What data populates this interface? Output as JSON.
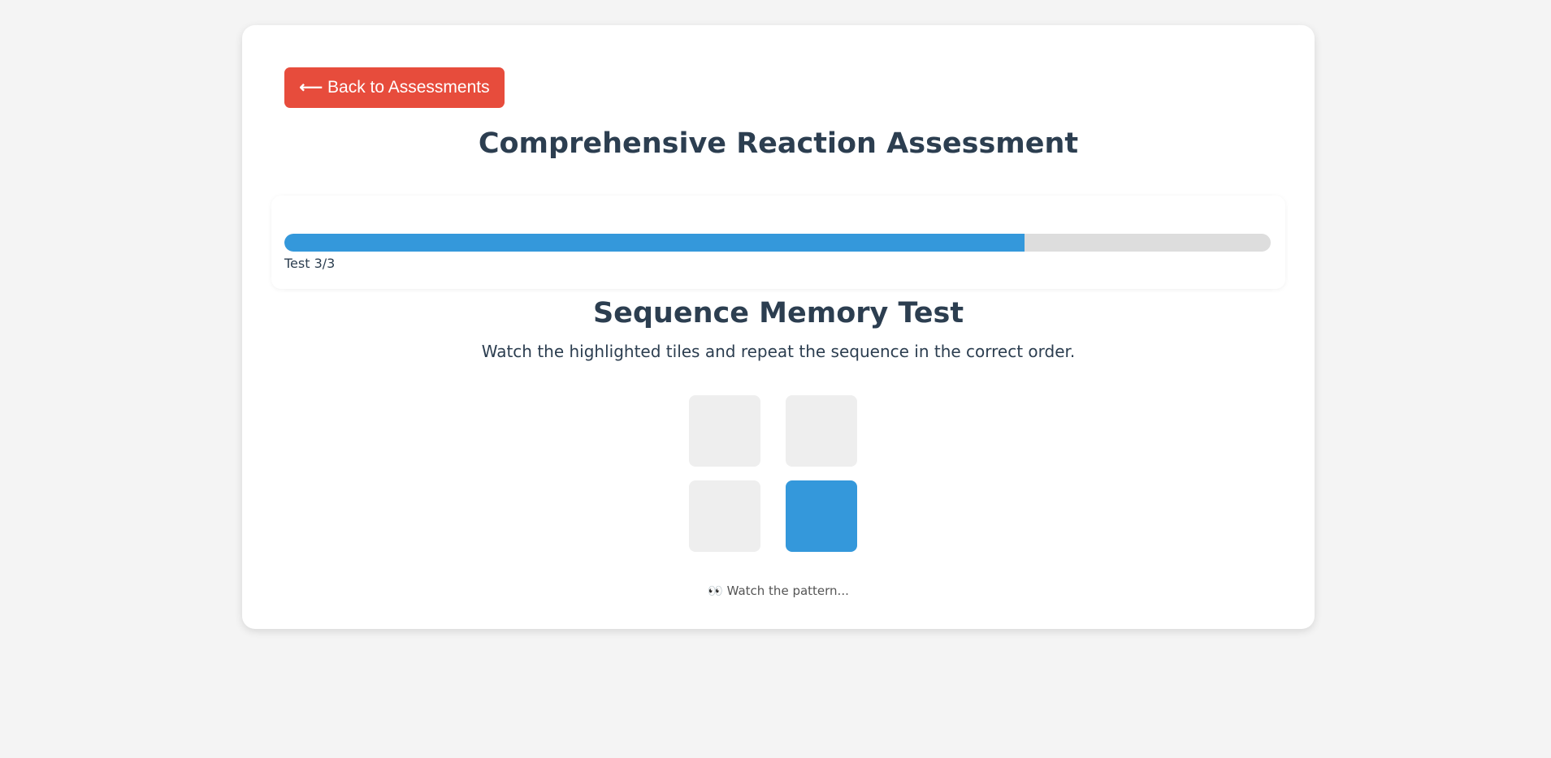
{
  "header": {
    "back_button_icon": "left-arrow-icon",
    "back_button_label": "Back to Assessments",
    "title": "Comprehensive Reaction Assessment"
  },
  "progress": {
    "fraction": 0.75,
    "label": "Test 3/3"
  },
  "test": {
    "title": "Sequence Memory Test",
    "instructions": "Watch the highlighted tiles and repeat the sequence in the correct order.",
    "tiles": [
      {
        "active": false
      },
      {
        "active": false
      },
      {
        "active": false
      },
      {
        "active": true
      }
    ],
    "status_icon": "eyes-emoji",
    "status_text": "👀 Watch the pattern..."
  },
  "colors": {
    "accent": "#3498db",
    "danger": "#e74c3c",
    "text": "#2c3e50",
    "tile_inactive": "#eeeeee",
    "track": "#dddddd",
    "background": "#f4f4f4"
  }
}
